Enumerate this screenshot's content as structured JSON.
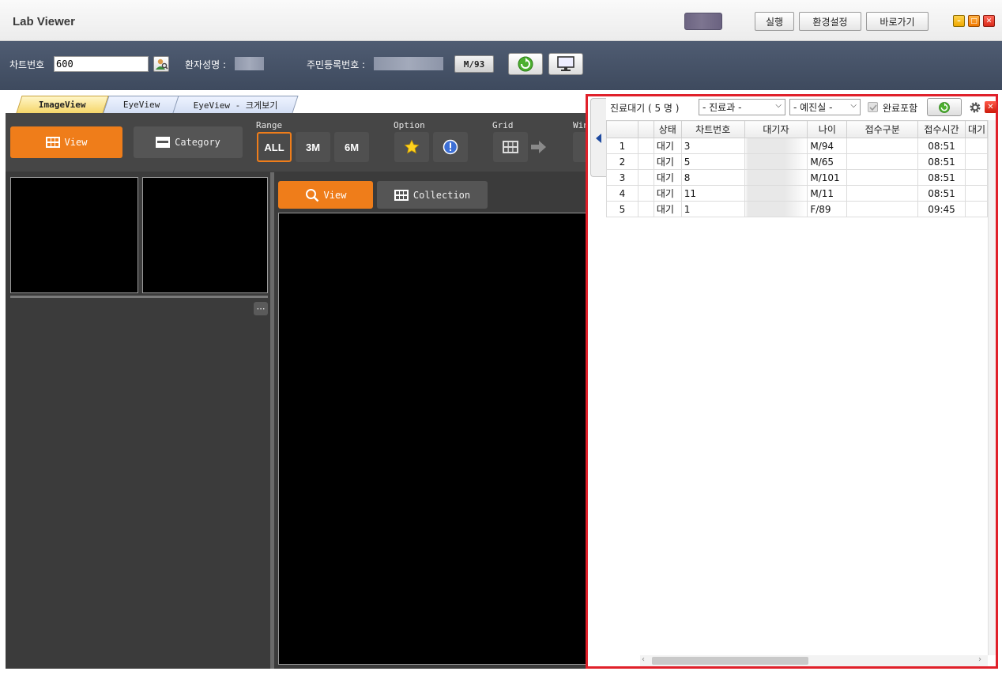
{
  "window": {
    "title": "Lab Viewer",
    "buttons": {
      "run": "실행",
      "settings": "환경설정",
      "shortcut": "바로가기"
    }
  },
  "search": {
    "chart_no_label": "차트번호",
    "chart_no_value": "600",
    "patient_name_label": "환자성명 :",
    "rrn_label": "주민등록번호 :",
    "sex_age": "M/93"
  },
  "tabs": [
    {
      "label": "ImageView",
      "active": true
    },
    {
      "label": "EyeView",
      "active": false
    },
    {
      "label": "EyeView - 크게보기",
      "active": false
    }
  ],
  "toolbar": {
    "view_label": "View",
    "category_label": "Category",
    "range_label": "Range",
    "range_options": [
      "ALL",
      "3M",
      "6M"
    ],
    "range_selected": "ALL",
    "option_label": "Option",
    "grid_label": "Grid",
    "window_label": "Window"
  },
  "viewer": {
    "view_label": "View",
    "collection_label": "Collection"
  },
  "waitlist": {
    "title": "진료대기 ( 5 명 )",
    "dept_select": "- 진료과 -",
    "room_select": "- 예진실 -",
    "include_done_label": "완료포함",
    "include_done_checked": true,
    "columns": [
      "",
      "",
      "상태",
      "차트번호",
      "대기자",
      "나이",
      "접수구분",
      "접수시간",
      "대기"
    ],
    "rows": [
      {
        "no": "1",
        "status": "대기",
        "chart": "3",
        "age": "M/94",
        "type": "",
        "time": "08:51"
      },
      {
        "no": "2",
        "status": "대기",
        "chart": "5",
        "age": "M/65",
        "type": "",
        "time": "08:51"
      },
      {
        "no": "3",
        "status": "대기",
        "chart": "8",
        "age": "M/101",
        "type": "",
        "time": "08:51"
      },
      {
        "no": "4",
        "status": "대기",
        "chart": "11",
        "age": "M/11",
        "type": "",
        "time": "08:51"
      },
      {
        "no": "5",
        "status": "대기",
        "chart": "1",
        "age": "F/89",
        "type": "",
        "time": "09:45"
      }
    ]
  },
  "colors": {
    "accent_orange": "#ef7d1a",
    "highlight_red": "#e0202a",
    "header_navy": "#45526a"
  },
  "icons": [
    "search-icon",
    "refresh-icon",
    "monitor-icon",
    "star-icon",
    "alert-icon",
    "grid-icon",
    "arrow-right-icon",
    "gear-icon",
    "close-icon",
    "more-icon"
  ]
}
